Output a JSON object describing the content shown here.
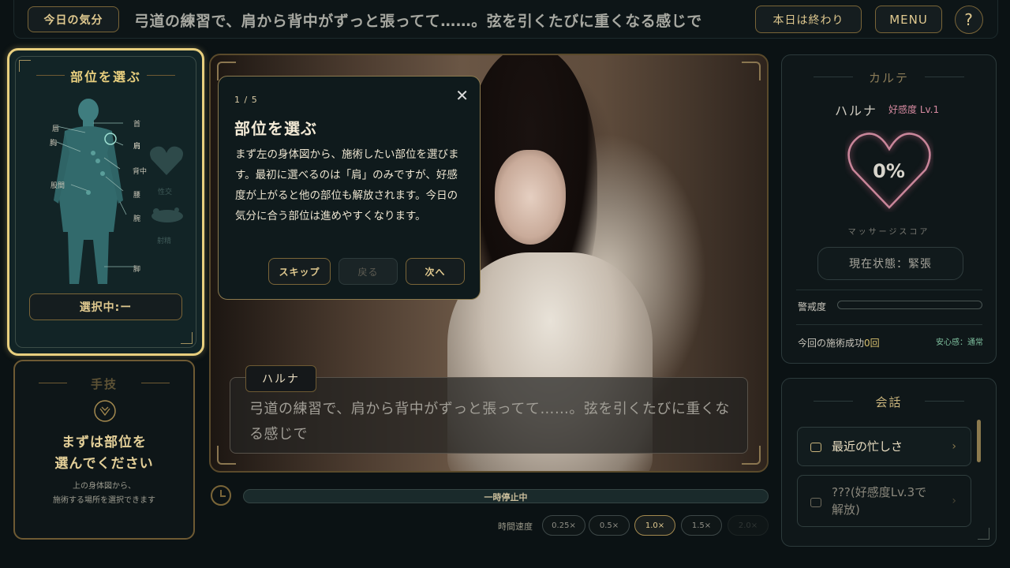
{
  "topbar": {
    "mood_button": "今日の気分",
    "mood_text": "弓道の練習で、肩から背中がずっと張ってて……。弦を引くたびに重くなる感じで",
    "end_button": "本日は終わり",
    "menu_button": "MENU",
    "help_button": "?"
  },
  "body_panel": {
    "title": "部位を選ぶ",
    "parts": {
      "neck": "首",
      "lips": "唇",
      "chest": "胸",
      "shoulder": "肩",
      "back": "背中",
      "crotch": "股間",
      "waist": "腰",
      "arm": "腕",
      "leg": "脚"
    },
    "locked": {
      "sex": "性交",
      "ejaculation": "射精"
    },
    "selected": "選択中:ー"
  },
  "tech_panel": {
    "title": "手技",
    "main_line1": "まずは部位を",
    "main_line2": "選んでください",
    "sub_line1": "上の身体図から、",
    "sub_line2": "施術する場所を選択できます"
  },
  "tutorial": {
    "step": "1 / 5",
    "close": "✕",
    "title": "部位を選ぶ",
    "body": "まず左の身体図から、施術したい部位を選びます。最初に選べるのは「肩」のみですが、好感度が上がると他の部位も解放されます。今日の気分に合う部位は進めやすくなります。",
    "skip": "スキップ",
    "back": "戻る",
    "next": "次へ"
  },
  "dialog": {
    "speaker": "ハルナ",
    "text": "弓道の練習で、肩から背中がずっと張ってて……。弦を引くたびに重くなる感じで"
  },
  "timeline": {
    "status": "一時停止中",
    "speed_label": "時間速度",
    "speeds": [
      "0.25×",
      "0.5×",
      "1.0×",
      "1.5×",
      "2.0×"
    ],
    "active_speed": "1.0×"
  },
  "karte": {
    "title": "カルテ",
    "name": "ハルナ",
    "affection": "好感度 Lv.1",
    "score": "0%",
    "score_label": "マッサージスコア",
    "state": "現在状態：緊張",
    "alert_label": "警戒度",
    "alert_level": 0,
    "success_label": "今回の施術成功",
    "success_value": "0回",
    "safety": "安心感：通常"
  },
  "conversation": {
    "title": "会話",
    "items": [
      {
        "text": "最近の忙しさ",
        "locked": false
      },
      {
        "text": "???(好感度Lv.3で解放)",
        "line1": "???(好感度Lv.3で",
        "line2": "解放)",
        "locked": true
      }
    ]
  },
  "colors": {
    "gold": "#e8cf7e",
    "accent_pink": "#d58aa0",
    "teal_panel": "#122426"
  }
}
